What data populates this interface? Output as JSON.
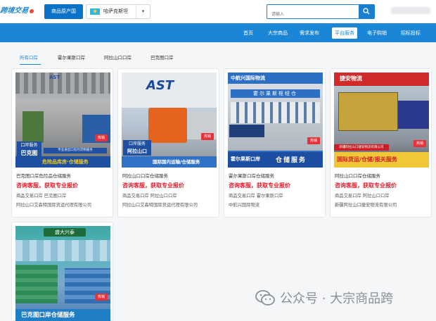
{
  "header": {
    "logo_text": "跨境交易",
    "origin_button": "商品原产国",
    "country": "哈萨克斯坦",
    "search_placeholder": "请输入",
    "user_name": ""
  },
  "nav": {
    "items": [
      {
        "label": "首页",
        "active": false
      },
      {
        "label": "大宗商品",
        "active": false
      },
      {
        "label": "需求发布",
        "active": false
      },
      {
        "label": "平台服务",
        "active": true
      },
      {
        "label": "电子购销",
        "active": false
      },
      {
        "label": "招标投标",
        "active": false
      }
    ]
  },
  "tabs": [
    {
      "label": "所有口岸",
      "active": true
    },
    {
      "label": "霍尔果斯口岸",
      "active": false
    },
    {
      "label": "阿拉山口口岸",
      "active": false
    },
    {
      "label": "巴克图口岸",
      "active": false
    }
  ],
  "cards": [
    {
      "title": "巴克图口岸危险品仓储服务",
      "cta": "咨询客服，获取专业报价",
      "meta1": "商品交易口岸  巴克图口岸",
      "meta2": "阿拉山口艾森特国际货运代理有限公司",
      "hot": "热销",
      "banner_top": "口岸服务",
      "banner_name": "巴克图",
      "banner_text": "危险品库房·仓储服务",
      "banner_sub": "专业进出口危险货物服务",
      "logo_text": "AST"
    },
    {
      "title": "阿拉山口口岸仓储服务",
      "cta": "咨询客服，获取专业报价",
      "meta1": "商品交易口岸  阿拉山口口岸",
      "meta2": "阿拉山口艾森特国际货运代理有限公司",
      "hot": "热销",
      "banner_top": "口岸服务",
      "banner_name": "阿拉山口",
      "banner_text": "国际国内运输/仓储服务",
      "logo_text": "AST"
    },
    {
      "title": "霍尔果斯口岸仓储服务",
      "cta": "咨询客服，获取专业报价",
      "meta1": "商品交易口岸  霍尔果斯口岸",
      "meta2": "中航兴国际物流",
      "hot": "热销",
      "banner_top": "中航兴国际物流",
      "banner_name": "霍尔果斯口岸",
      "banner_text": "仓储服务",
      "building_sign": "霍尔果斯枢纽仓"
    },
    {
      "title": "阿拉山口口岸仓储服务",
      "cta": "咨询客服，获取专业报价",
      "meta1": "商品交易口岸  阿拉山口口岸",
      "meta2": "新疆阿拉山口捷安物流有限公司",
      "hot": "热销",
      "banner_top": "捷安物流",
      "banner_strip": "新疆阿拉山口捷安物流有限公司",
      "banner_text": "国际货运/仓储/报关服务"
    },
    {
      "title": "",
      "cta": "",
      "meta1": "",
      "meta2": "",
      "hot": "热销",
      "banner_top": "盛大兴泰",
      "banner_text": "巴克图口岸仓储服务"
    }
  ],
  "watermark": "公众号 · 大宗商品跨",
  "colors": {
    "primary": "#1b86d6",
    "accent_red": "#e3192a",
    "nav_bg": "#1b86d6"
  }
}
